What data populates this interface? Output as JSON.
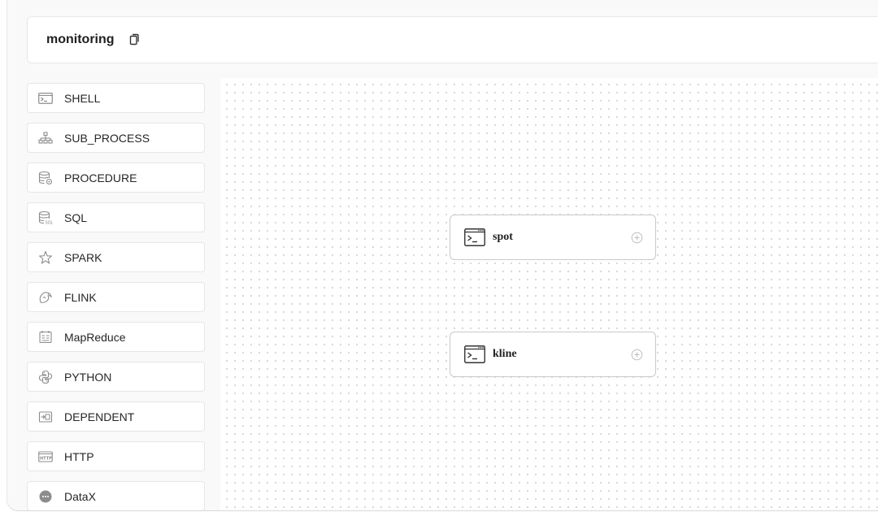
{
  "workflow": {
    "title": "monitoring",
    "copy_icon": "copy-icon"
  },
  "toolbox": {
    "items": [
      {
        "label": "SHELL",
        "icon": "terminal-icon"
      },
      {
        "label": "SUB_PROCESS",
        "icon": "hierarchy-icon"
      },
      {
        "label": "PROCEDURE",
        "icon": "database-gear-icon"
      },
      {
        "label": "SQL",
        "icon": "database-sql-icon"
      },
      {
        "label": "SPARK",
        "icon": "spark-star-icon"
      },
      {
        "label": "FLINK",
        "icon": "flink-squirrel-icon"
      },
      {
        "label": "MapReduce",
        "icon": "mapreduce-icon"
      },
      {
        "label": "PYTHON",
        "icon": "python-icon"
      },
      {
        "label": "DEPENDENT",
        "icon": "dependent-icon"
      },
      {
        "label": "HTTP",
        "icon": "http-icon"
      },
      {
        "label": "DataX",
        "icon": "datax-icon"
      }
    ]
  },
  "canvas": {
    "nodes": [
      {
        "label": "spot",
        "type_icon": "terminal-icon",
        "action_icon": "add-circle-icon"
      },
      {
        "label": "kline",
        "type_icon": "terminal-icon",
        "action_icon": "add-circle-icon"
      }
    ]
  },
  "colors": {
    "page_bg": "#f9f9f9",
    "border": "#e6e6e6",
    "node_border": "#c9c9c9",
    "icon_gray": "#8c8c8c",
    "text": "#262626"
  }
}
